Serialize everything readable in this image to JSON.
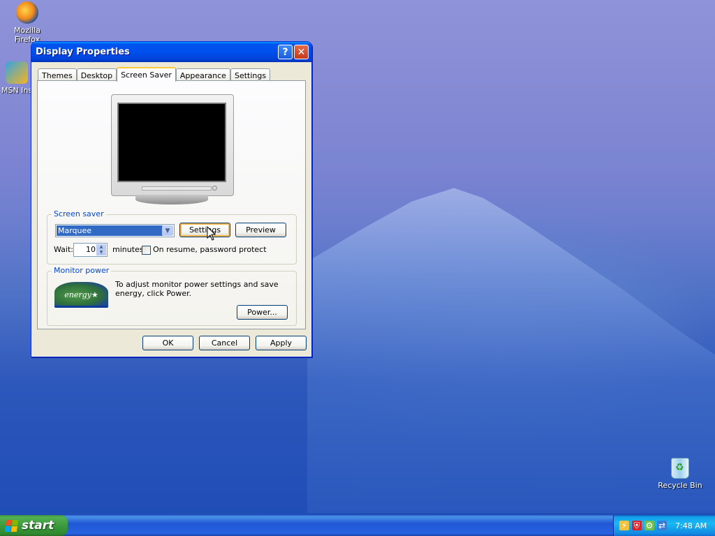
{
  "desktop": {
    "icons": [
      {
        "label": "Mozilla Firefox"
      },
      {
        "label": "MSN Ins"
      },
      {
        "label": "Recycle Bin"
      }
    ]
  },
  "dialog": {
    "title": "Display Properties",
    "help_glyph": "?",
    "close_glyph": "✕",
    "tabs": [
      {
        "label": "Themes"
      },
      {
        "label": "Desktop"
      },
      {
        "label": "Screen Saver",
        "active": true
      },
      {
        "label": "Appearance"
      },
      {
        "label": "Settings"
      }
    ],
    "screensaver": {
      "group_label": "Screen saver",
      "selected": "Marquee",
      "settings_label": "Settings",
      "preview_label": "Preview",
      "wait_label": "Wait:",
      "wait_value": "10",
      "minutes_label": "minutes",
      "password_label": "On resume, password protect",
      "password_checked": false
    },
    "monitor_power": {
      "group_label": "Monitor power",
      "description": "To adjust monitor power settings and save energy, click Power.",
      "power_label": "Power...",
      "logo_text": "energy"
    },
    "buttons": {
      "ok": "OK",
      "cancel": "Cancel",
      "apply": "Apply"
    }
  },
  "taskbar": {
    "start_label": "start",
    "clock": "7:48 AM",
    "tray_icons": [
      "network-icon",
      "security-shield-icon",
      "update-icon",
      "connection-icon"
    ]
  },
  "colors": {
    "titlebar": "#0053ee",
    "selection": "#316ac5",
    "group_label": "#0046d5",
    "start_green": "#3d9a3d"
  }
}
